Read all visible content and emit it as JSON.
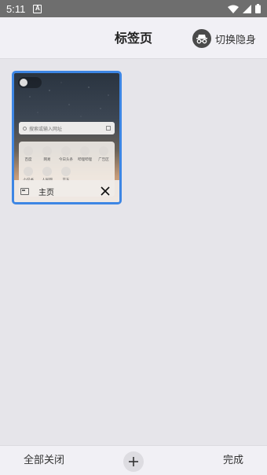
{
  "status_bar": {
    "time": "5:11",
    "notification_icon": "a-notification-icon",
    "wifi_icon": "wifi-icon",
    "signal_icon": "signal-icon",
    "battery_icon": "battery-icon"
  },
  "header": {
    "title": "标签页",
    "incognito_label": "切换隐身",
    "incognito_icon": "incognito-icon"
  },
  "tabs": [
    {
      "title": "主页",
      "thumbnail": {
        "search_placeholder": "搜索或输入网址",
        "shortcuts": [
          "百度",
          "网易",
          "今日头条",
          "哔哩哔哩",
          "广告区",
          "小说书",
          "人民网",
          "京东"
        ]
      }
    }
  ],
  "bottom_bar": {
    "close_all_label": "全部关闭",
    "add_icon": "plus-icon",
    "done_label": "完成"
  },
  "colors": {
    "accent": "#3d86e4",
    "background": "#e6e5ea",
    "bar": "#f1f0f5",
    "status_bar": "#6e6e6e"
  }
}
